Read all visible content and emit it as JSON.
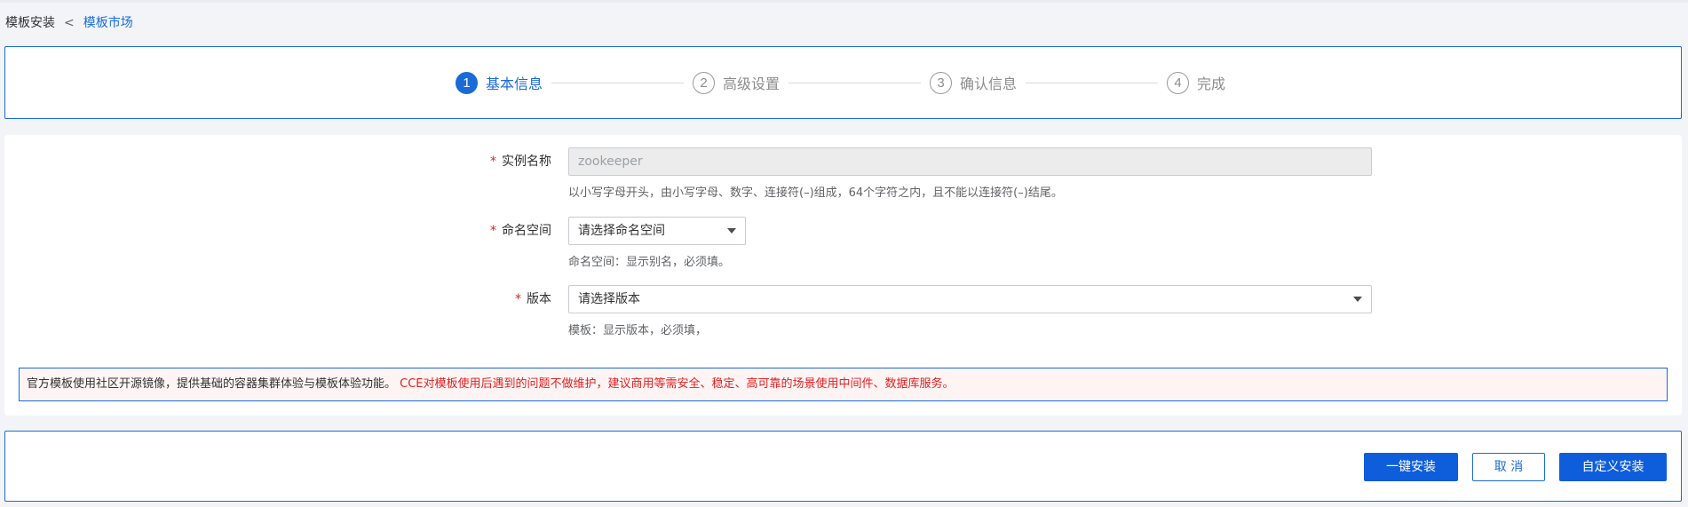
{
  "breadcrumb": {
    "current": "模板安装",
    "separator": "<",
    "parent": "模板市场"
  },
  "steps": [
    {
      "num": "1",
      "label": "基本信息",
      "active": true
    },
    {
      "num": "2",
      "label": "高级设置",
      "active": false
    },
    {
      "num": "3",
      "label": "确认信息",
      "active": false
    },
    {
      "num": "4",
      "label": "完成",
      "active": false
    }
  ],
  "form": {
    "required_mark": "*",
    "instance_name": {
      "label": "实例名称",
      "value": "zookeeper",
      "hint": "以小写字母开头，由小写字母、数字、连接符(–)组成，64个字符之内，且不能以连接符(–)结尾。"
    },
    "namespace": {
      "label": "命名空间",
      "placeholder": "请选择命名空间",
      "hint": "命名空间：显示别名，必须填。"
    },
    "version": {
      "label": "版本",
      "placeholder": "请选择版本",
      "hint": "模板：显示版本，必须填，"
    }
  },
  "notice": {
    "text": "官方模板使用社区开源镜像，提供基础的容器集群体验与模板体验功能。",
    "warning": "CCE对模板使用后遇到的问题不做维护，建议商用等需安全、稳定、高可靠的场景使用中间件、数据库服务。"
  },
  "actions": {
    "one_click_install": "一键安装",
    "cancel": "取 消",
    "custom_install": "自定义安装"
  },
  "colors": {
    "primary": "#1a6bd6",
    "required": "#e02020"
  }
}
